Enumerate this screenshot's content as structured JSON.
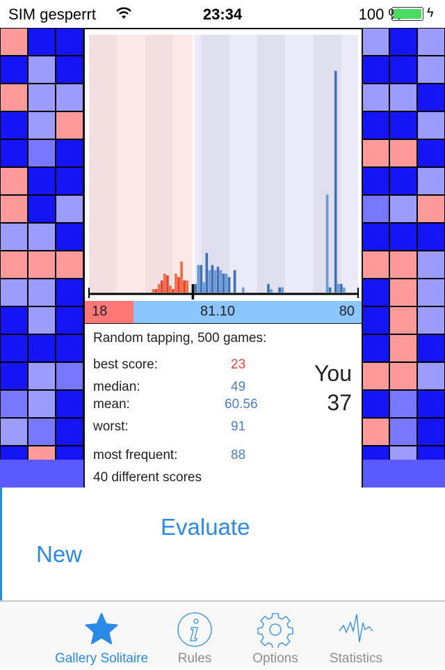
{
  "status_bar": {
    "carrier": "SIM gesperrt",
    "time": "23:34",
    "battery": "100 %",
    "battery_level": 1.0
  },
  "board": {
    "palette": {
      "P": "#ff9a9a",
      "B": "#1414f5",
      "L": "#9c9cff",
      "M": "#7777ff"
    },
    "left": [
      "PBB",
      "BLB",
      "PLL",
      "BLP",
      "BMB",
      "PBB",
      "PBL",
      "LLB",
      "PPP",
      "LLB",
      "BLB",
      "BBB",
      "BLM",
      "MLB",
      "LMB",
      "BPB"
    ],
    "right": [
      "LBL",
      "BBL",
      "LLB",
      "BBL",
      "PPB",
      "BBL",
      "MLP",
      "BBB",
      "PPL",
      "BPL",
      "BPL",
      "BPB",
      "PPL",
      "BMB",
      "PMB",
      "BLB"
    ]
  },
  "chart_data": {
    "type": "bar",
    "title": "",
    "xlabel": "",
    "ylabel": "",
    "xlim": [
      0,
      96
    ],
    "ylim": [
      0,
      150
    ],
    "marker": 37,
    "x": [
      23,
      24,
      25,
      26,
      27,
      28,
      29,
      30,
      31,
      32,
      33,
      34,
      35,
      38,
      39,
      40,
      41,
      42,
      43,
      44,
      45,
      46,
      47,
      48,
      49,
      50,
      52,
      55,
      64,
      65,
      68,
      69,
      85,
      86,
      88,
      89,
      90,
      91
    ],
    "values": [
      2,
      2,
      5,
      7,
      11,
      10,
      4,
      2,
      11,
      9,
      18,
      7,
      7,
      5,
      16,
      16,
      6,
      23,
      13,
      16,
      13,
      15,
      13,
      11,
      11,
      9,
      13,
      3,
      5,
      2,
      3,
      3,
      57,
      3,
      129,
      5,
      5,
      3
    ],
    "colors": {
      "better": "#e8402a",
      "better_alt": "#f26a40",
      "worse": "#3f6fb8",
      "worse_alt": "#6a9bd4"
    },
    "scale_labels": {
      "left": "18",
      "center": "81.10",
      "right": "80"
    }
  },
  "info": {
    "heading": "Random tapping, 500 games:",
    "rows": [
      {
        "label": "best score:",
        "value": "23",
        "color": "#e84040"
      },
      {
        "label": "median:",
        "value": "49"
      },
      {
        "label": "mean:",
        "value": "60.56"
      },
      {
        "label": "worst:",
        "value": "91"
      },
      {
        "label": "most frequent:",
        "value": "88"
      }
    ],
    "different": "40 different scores",
    "you_label": "You",
    "you_score": "37"
  },
  "buttons": {
    "evaluate": "Evaluate",
    "new": "New"
  },
  "tabs": [
    {
      "label": "Gallery Solitaire",
      "icon": "star-icon",
      "active": true
    },
    {
      "label": "Rules",
      "icon": "info-icon"
    },
    {
      "label": "Options",
      "icon": "gear-icon"
    },
    {
      "label": "Statistics",
      "icon": "pulse-icon"
    }
  ],
  "accent": "#2a8ae8"
}
